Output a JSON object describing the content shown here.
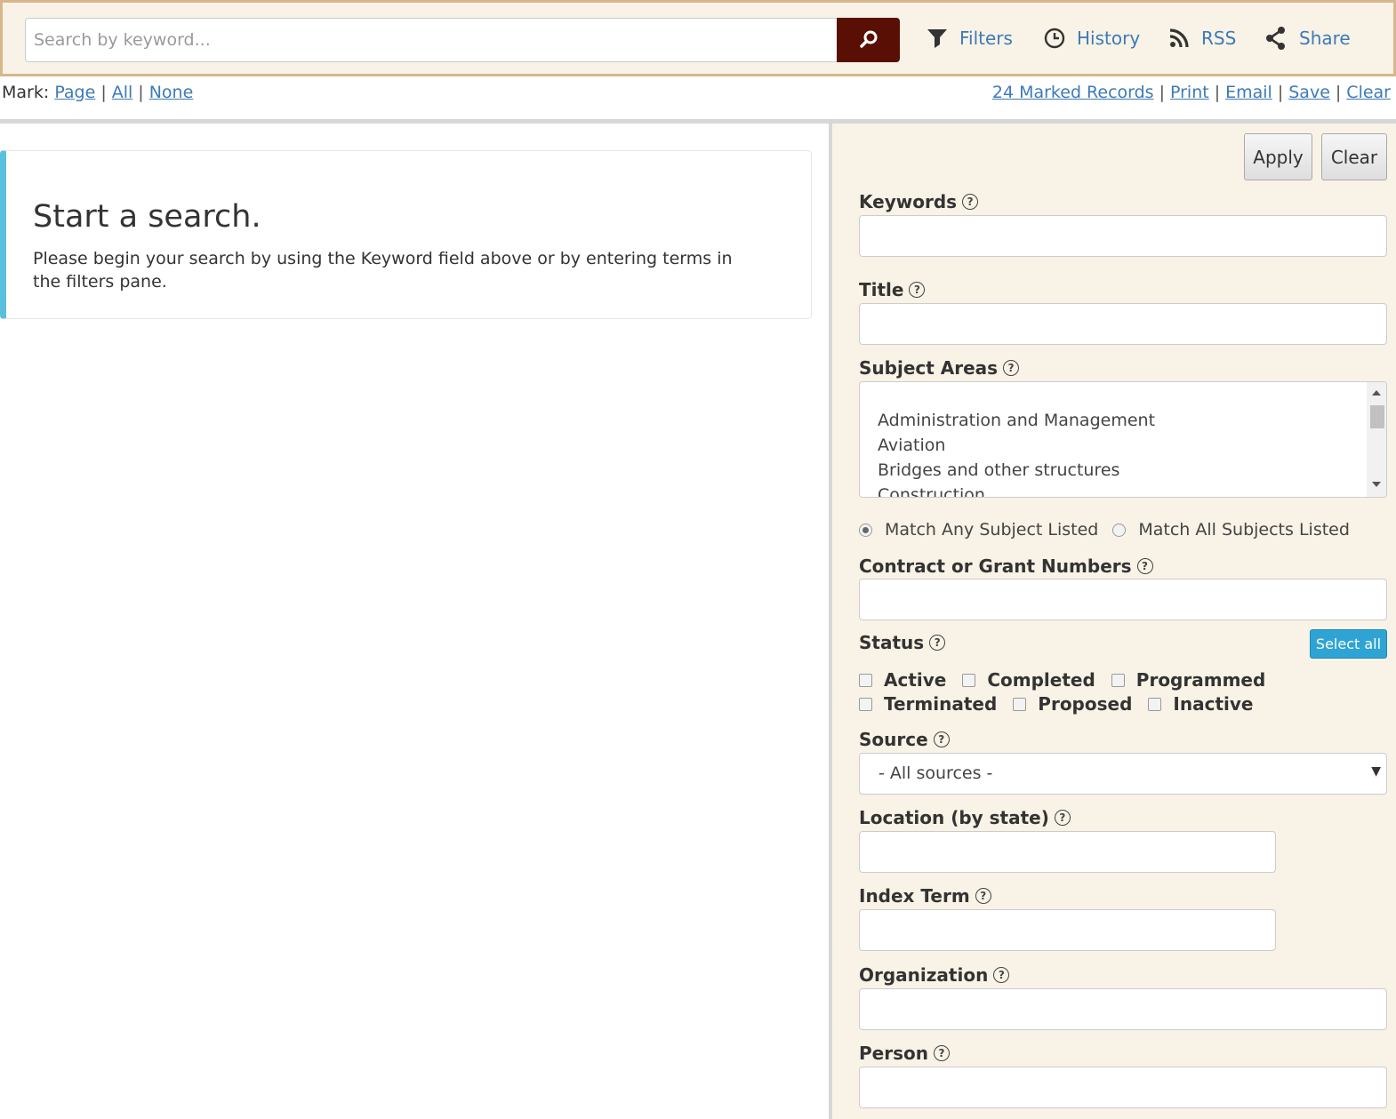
{
  "search": {
    "placeholder": "Search by keyword...",
    "tools": {
      "filters": "Filters",
      "history": "History",
      "rss": "RSS",
      "share": "Share"
    }
  },
  "mark": {
    "label": "Mark:",
    "page": "Page",
    "all": "All",
    "none": "None",
    "marked_records": "24 Marked Records",
    "print": "Print",
    "email": "Email",
    "save": "Save",
    "clear": "Clear"
  },
  "main": {
    "heading": "Start a search.",
    "message": "Please begin your search by using the Keyword field above or by entering terms in the filters pane."
  },
  "filters": {
    "apply": "Apply",
    "clear": "Clear",
    "keywords": "Keywords",
    "title": "Title",
    "subject_areas": "Subject Areas",
    "subject_options": [
      "Administration and Management",
      "Aviation",
      "Bridges and other structures",
      "Construction"
    ],
    "match_any": "Match Any Subject Listed",
    "match_all": "Match All Subjects Listed",
    "contract": "Contract or Grant Numbers",
    "status": "Status",
    "select_all": "Select all",
    "status_options": [
      "Active",
      "Completed",
      "Programmed",
      "Terminated",
      "Proposed",
      "Inactive"
    ],
    "source": "Source",
    "source_value": "- All sources -",
    "location": "Location (by state)",
    "index_term": "Index Term",
    "organization": "Organization",
    "person": "Person"
  },
  "colors": {
    "accent_link": "#3d7ab8",
    "search_button": "#5a0f05",
    "top_border": "#d8b68c",
    "pane_bg": "#f8f3e6",
    "callout_accent": "#5bc0de",
    "select_all_bg": "#2fa4d4"
  }
}
